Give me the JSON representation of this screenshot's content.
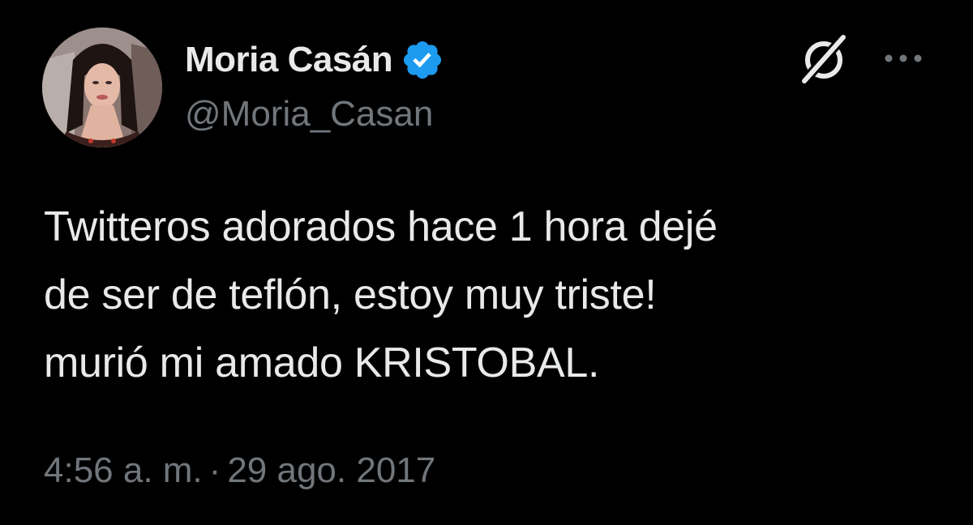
{
  "author": {
    "display_name": "Moria Casán",
    "handle": "@Moria_Casan",
    "verified": true
  },
  "icons": {
    "verified": "verified-badge-icon",
    "grok": "grok-icon",
    "more": "more-options-icon"
  },
  "tweet": {
    "lines": [
      "Twitteros adorados hace 1 hora dejé",
      "de ser de teflón, estoy muy triste!",
      "murió mi amado KRISTOBAL."
    ],
    "time": "4:56 a. m.",
    "separator": "·",
    "date": "29 ago. 2017"
  },
  "colors": {
    "background": "#000000",
    "text": "#e7e9ea",
    "secondary": "#71767b",
    "verified_blue": "#1d9bf0"
  }
}
